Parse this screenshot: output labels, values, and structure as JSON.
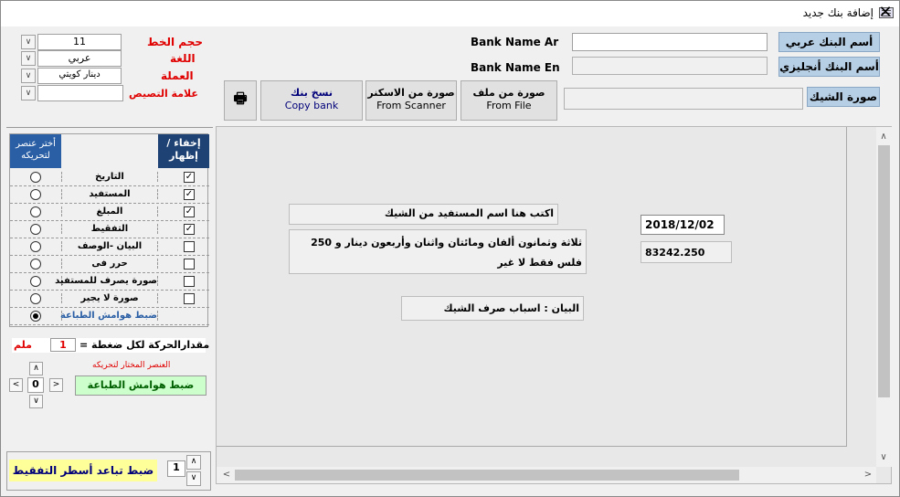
{
  "window": {
    "title": "إضافة بنك جديد",
    "close": "✕"
  },
  "format": {
    "font_size_label": "حجم الخط",
    "font_size_value": "11",
    "language_label": "اللغة",
    "language_value": "عربي",
    "currency_label": "العملة",
    "currency_value": "دينار كويتي",
    "crossing_label": "علامة التصيص",
    "crossing_value": ""
  },
  "bank": {
    "name_ar_label": "Bank Name Ar",
    "name_ar_value": "",
    "name_en_label": "Bank Name En",
    "name_en_value": "",
    "btn_name_ar": "أسم البنك عربي",
    "btn_name_en": "أسم البنك أنجليزي",
    "btn_check_image": "صورة الشيك",
    "check_image_value": ""
  },
  "toolbar": {
    "from_file_ar": "صورة من ملف",
    "from_file_en": "From File",
    "from_scanner_ar": "صورة من الاسكنر",
    "from_scanner_en": "From Scanner",
    "copy_bank_ar": "نسخ بنك",
    "copy_bank_en": "Copy bank"
  },
  "elements_grid": {
    "header_select": "أختر عنصر لتحريكه",
    "header_toggle": "إخفاء / إظهار",
    "rows": [
      {
        "label": "التاريخ",
        "checked": true,
        "selected": false
      },
      {
        "label": "المستفيد",
        "checked": true,
        "selected": false
      },
      {
        "label": "المبلغ",
        "checked": true,
        "selected": false
      },
      {
        "label": "التفقيط",
        "checked": true,
        "selected": false
      },
      {
        "label": "البيان -الوصف",
        "checked": false,
        "selected": false
      },
      {
        "label": "حرر فى",
        "checked": false,
        "selected": false
      },
      {
        "label": "صورة يصرف للمستفيد",
        "checked": false,
        "selected": false
      },
      {
        "label": "صورة لا يجير",
        "checked": false,
        "selected": false
      },
      {
        "label": "ضبط هوامش الطباعة",
        "checked": false,
        "selected": true
      }
    ]
  },
  "movement": {
    "step_label": "مقدارالحركة لكل ضغطة =",
    "step_value": "1",
    "step_unit": "ملم",
    "selected_label": "العنصر المختار لتحريكه",
    "selected_value": "ضبط هوامش الطباعة",
    "center_value": "0",
    "up": "∧",
    "down": "∨",
    "left": "<",
    "right": ">"
  },
  "line_spacing": {
    "label": "ضبط تباعد أسطر التفقيط",
    "value": "1",
    "up": "∧",
    "down": "∨"
  },
  "check_preview": {
    "payee": "اكتب هنا اسم المستفيد من الشيك",
    "amount_words": "ثلاثة وثمانون ألفان ومائتان واثنان وأربعون دينار و 250 فلس فقط لا غير",
    "date": "2018/12/02",
    "amount": "83242.250",
    "memo": "البيان : اسباب صرف الشيك"
  },
  "colors": {
    "red_label": "#e00000",
    "header_blue": "#2a5fa5",
    "button_blue": "#b7cfe5",
    "yellow_panel": "#ffff99",
    "green_panel": "#ccffcc"
  }
}
